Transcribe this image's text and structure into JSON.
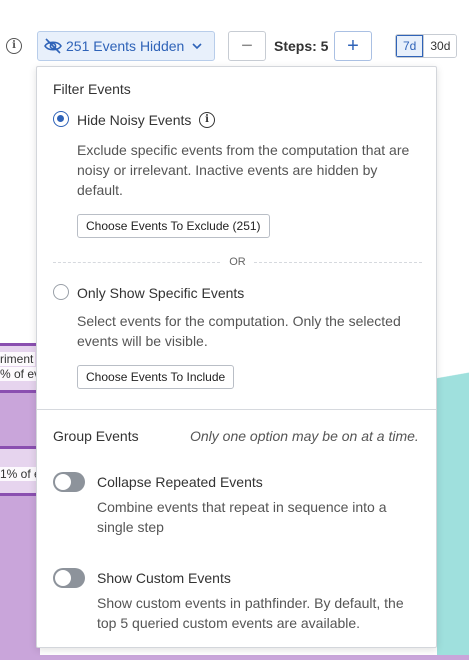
{
  "toolbar": {
    "hidden_label": "251 Events Hidden",
    "minus": "−",
    "steps_label": "Steps: 5",
    "plus": "+",
    "ranges": [
      "7d",
      "30d"
    ]
  },
  "background": {
    "label1_line1": "riment",
    "label1_line2": "% of ev",
    "label2": "1% of e"
  },
  "popover": {
    "filter_title": "Filter Events",
    "hide_noisy": {
      "label": "Hide Noisy Events",
      "checked": true,
      "description": "Exclude specific events from the computation that are noisy or irrelevant. Inactive events are hidden by default.",
      "button": "Choose Events To Exclude (251)"
    },
    "or_text": "OR",
    "only_show": {
      "label": "Only Show Specific Events",
      "checked": false,
      "description": "Select events for the computation. Only the selected events will be visible.",
      "button": "Choose Events To Include"
    },
    "group_title": "Group Events",
    "group_note": "Only one option may be on at a time.",
    "collapse": {
      "label": "Collapse Repeated Events",
      "on": false,
      "description": "Combine events that repeat in sequence into a single step"
    },
    "custom": {
      "label": "Show Custom Events",
      "on": false,
      "description": "Show custom events in pathfinder. By default, the top 5 queried custom events are available."
    }
  },
  "colors": {
    "accent": "#2f63b8",
    "purple": "#c9a5da",
    "teal": "#9fe0dd"
  }
}
